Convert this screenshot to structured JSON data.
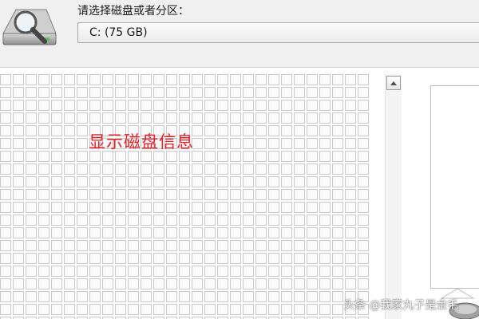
{
  "header": {
    "prompt_label": "请选择磁盘或者分区：",
    "selected_drive": "C:  (75 GB)"
  },
  "grid": {
    "overlay_text": "显示磁盘信息"
  },
  "watermark": "头条 @我家丸子是金毛",
  "colors": {
    "header_bg": "#f0f0f0",
    "cell_border": "#c9c9c9",
    "overlay_text": "#e0222a"
  },
  "icons": {
    "header": "disk-magnifier-icon",
    "scroll_up": "arrow-up-icon",
    "panel_bottom": "disk-icon"
  }
}
